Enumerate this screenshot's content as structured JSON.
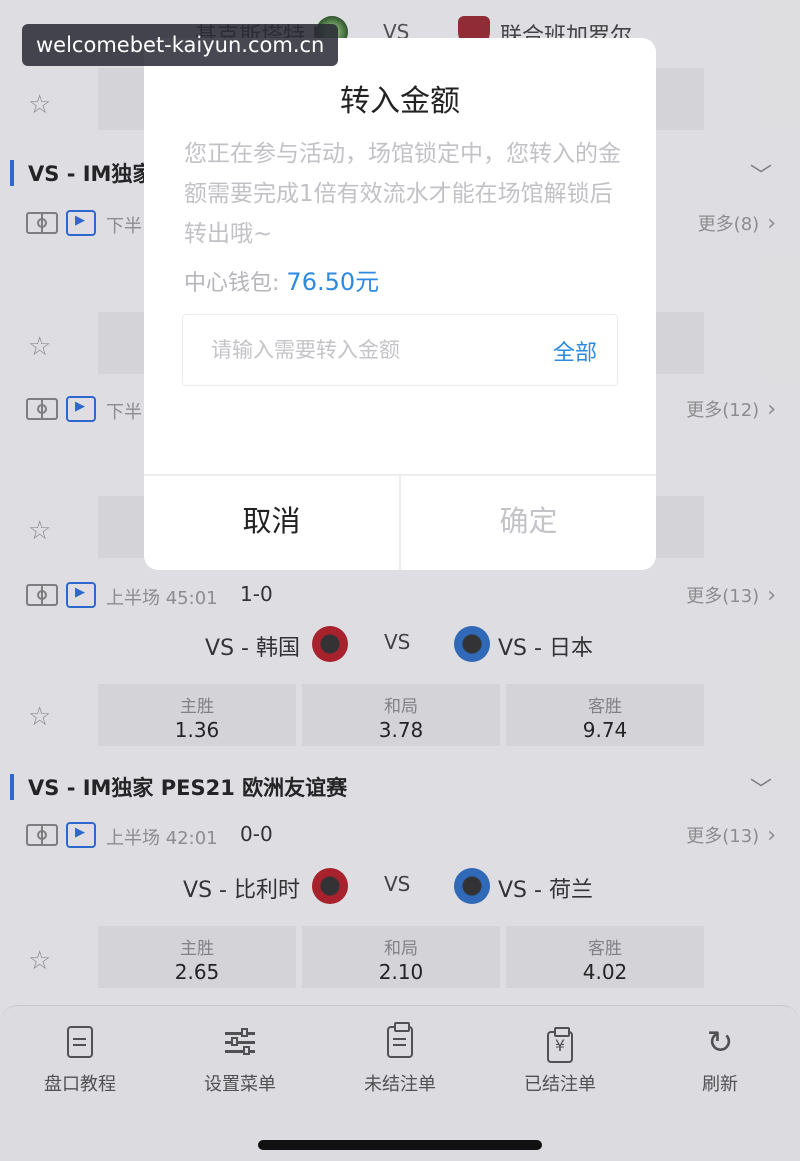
{
  "watermark": "welcomebet-kaiyun.com.cn",
  "top_match": {
    "home": "基克斯塔特 FC",
    "vs": "VS",
    "away": "联合班加罗尔"
  },
  "leagues": [
    {
      "title": "VS - IM独家"
    },
    {
      "title": "VS - IM独家 PES21 欧洲友谊赛"
    }
  ],
  "matches": [
    {
      "period": "下半",
      "score": "",
      "more": "更多(8)",
      "home": "",
      "away": "",
      "odds": [
        "",
        "",
        ""
      ]
    },
    {
      "period": "下半",
      "score": "",
      "more": "更多(12)",
      "home": "",
      "away": "",
      "odds": [
        "",
        "",
        ""
      ]
    },
    {
      "period": "上半场 45:01",
      "score": "1-0",
      "more": "更多(13)",
      "home": "VS - 韩国",
      "away": "VS - 日本",
      "odds": [
        "1.36",
        "3.78",
        "9.74"
      ]
    },
    {
      "period": "上半场 42:01",
      "score": "0-0",
      "more": "更多(13)",
      "home": "VS - 比利时",
      "away": "VS - 荷兰",
      "odds": [
        "2.65",
        "2.10",
        "4.02"
      ]
    }
  ],
  "odds_labels": {
    "home": "主胜",
    "draw": "和局",
    "away": "客胜"
  },
  "vs_label": "VS",
  "dialog": {
    "title": "转入金额",
    "description": "您正在参与活动，场馆锁定中，您转入的金额需要完成1倍有效流水才能在场馆解锁后转出哦~",
    "wallet_label": "中心钱包:",
    "wallet_amount": "76.50元",
    "input_placeholder": "请输入需要转入金额",
    "all_label": "全部",
    "cancel_label": "取消",
    "confirm_label": "确定"
  },
  "bottom_nav": [
    {
      "label": "盘口教程",
      "icon": "document-icon"
    },
    {
      "label": "设置菜单",
      "icon": "sliders-icon"
    },
    {
      "label": "未结注单",
      "icon": "clipboard-icon"
    },
    {
      "label": "已结注单",
      "icon": "yen-clipboard-icon"
    },
    {
      "label": "刷新",
      "icon": "refresh-icon"
    }
  ],
  "colors": {
    "accent": "#2d8ae0",
    "league_bar": "#2d6fe0",
    "home_crest": "#b81f2a",
    "away_crest": "#2e70c8"
  }
}
